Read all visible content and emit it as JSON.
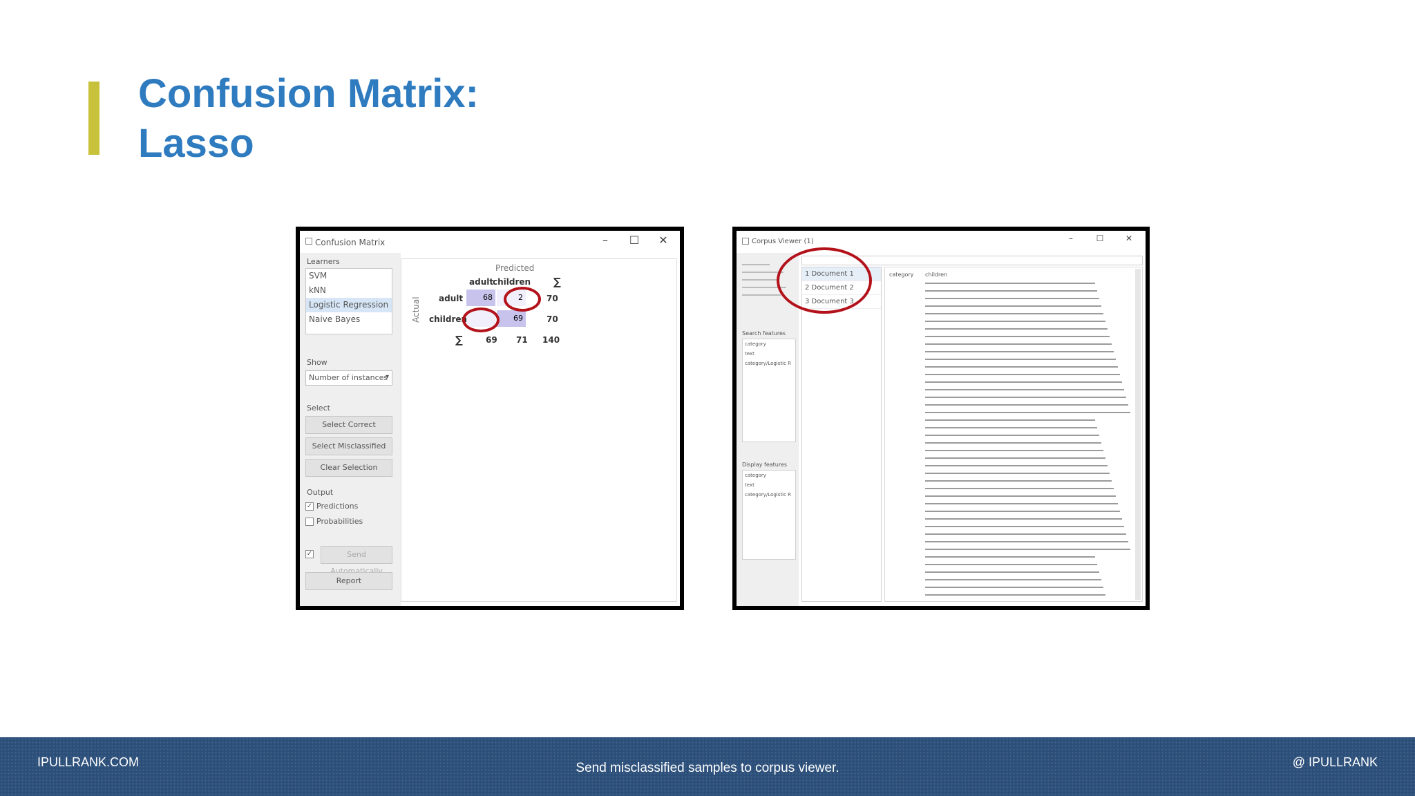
{
  "slide": {
    "title_line1": "Confusion Matrix:",
    "title_line2": "Lasso",
    "footer_left": "IPULLRANK.COM",
    "footer_center": "Send misclassified samples to corpus viewer.",
    "footer_right": "@ IPULLRANK"
  },
  "colors": {
    "title": "#2f7bbf",
    "accent_bar": "#c8c23a",
    "footer_bg": "#2c4f7a",
    "highlight_oval": "#b3121b"
  },
  "confusion_window": {
    "title": "Confusion Matrix",
    "controls": [
      "–",
      "☐",
      "✕"
    ],
    "learners_label": "Learners",
    "learners": [
      {
        "label": "SVM",
        "selected": false
      },
      {
        "label": "kNN",
        "selected": false
      },
      {
        "label": "Logistic Regression",
        "selected": true
      },
      {
        "label": "Naive Bayes",
        "selected": false
      }
    ],
    "show_label": "Show",
    "show_value": "Number of instances",
    "select_label": "Select",
    "buttons": {
      "select_correct": "Select Correct",
      "select_misclassified": "Select Misclassified",
      "clear_selection": "Clear Selection"
    },
    "output_label": "Output",
    "predictions": {
      "label": "Predictions",
      "checked": true
    },
    "probabilities": {
      "label": "Probabilities",
      "checked": false
    },
    "send_auto": "Send Automatically",
    "report": "Report",
    "matrix": {
      "predicted_label": "Predicted",
      "actual_label": "Actual",
      "sum_symbol": "∑",
      "col_headers": [
        "adult",
        "children"
      ],
      "rows": [
        {
          "label": "adult",
          "cells": [
            "68",
            "2"
          ],
          "total": "70"
        },
        {
          "label": "children",
          "cells": [
            "",
            "69"
          ],
          "total": "70"
        }
      ],
      "col_totals": [
        "69",
        "71"
      ],
      "grand_total": "140"
    }
  },
  "corpus_window": {
    "title": "Corpus Viewer (1)",
    "controls": [
      "–",
      "☐",
      "✕"
    ],
    "search_features_label": "Search features",
    "display_features_label": "Display features",
    "features": [
      "category",
      "text",
      "category/Logistic R"
    ],
    "documents": [
      "1 Document 1",
      "2 Document 2",
      "3 Document 3"
    ],
    "column_headers": [
      "category",
      "children"
    ]
  }
}
